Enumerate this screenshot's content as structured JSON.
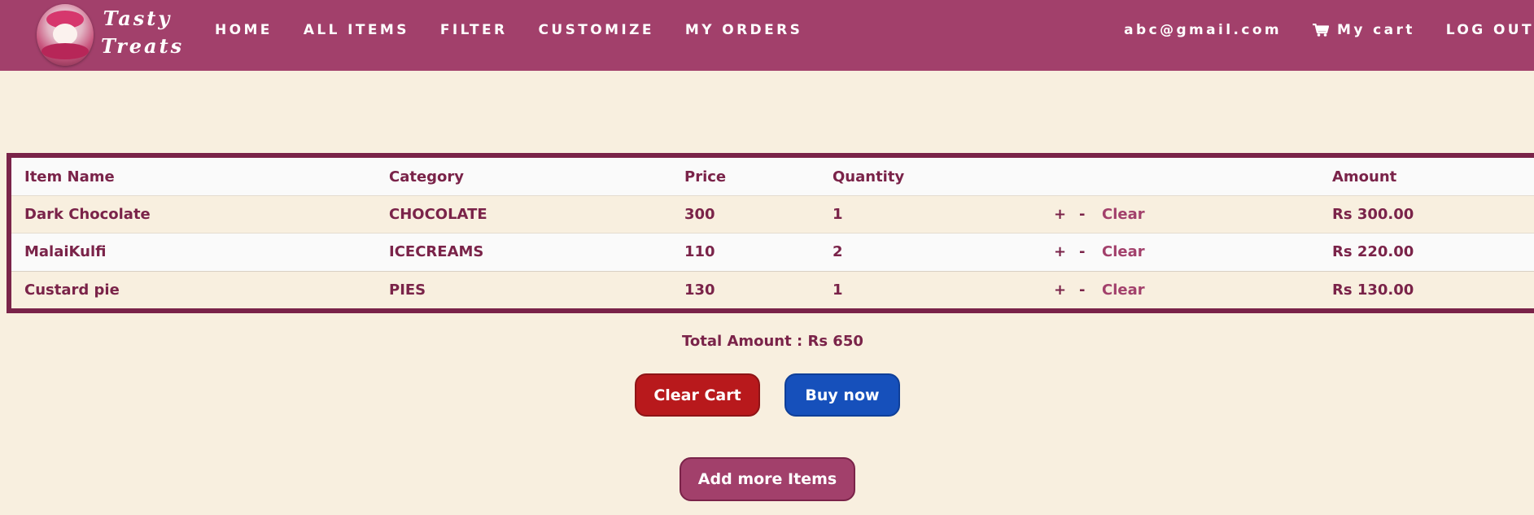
{
  "brand": {
    "line1": "Tasty",
    "line2": "Treats"
  },
  "nav": {
    "links": [
      "HOME",
      "ALL ITEMS",
      "FILTER",
      "CUSTOMIZE",
      "MY ORDERS"
    ],
    "user_email": "abc@gmail.com",
    "cart_label": "My cart",
    "logout_label": "LOG OUT"
  },
  "table": {
    "headers": {
      "name": "Item Name",
      "category": "Category",
      "price": "Price",
      "quantity": "Quantity",
      "amount": "Amount"
    },
    "rows": [
      {
        "name": "Dark Chocolate",
        "category": "CHOCOLATE",
        "price": "300",
        "quantity": "1",
        "plus": "+",
        "minus": "-",
        "clear": "Clear",
        "amount": "Rs 300.00"
      },
      {
        "name": "MalaiKulfi",
        "category": "ICECREAMS",
        "price": "110",
        "quantity": "2",
        "plus": "+",
        "minus": "-",
        "clear": "Clear",
        "amount": "Rs 220.00"
      },
      {
        "name": "Custard pie",
        "category": "PIES",
        "price": "130",
        "quantity": "1",
        "plus": "+",
        "minus": "-",
        "clear": "Clear",
        "amount": "Rs 130.00"
      }
    ]
  },
  "summary": {
    "total_text": "Total Amount : Rs 650"
  },
  "buttons": {
    "clear_cart": "Clear Cart",
    "buy_now": "Buy now",
    "add_more": "Add more Items"
  },
  "colors": {
    "navbar": "#a2406b",
    "text": "#7a2349",
    "background": "#f8efdf",
    "clear_cart": "#b8191c",
    "buy_now": "#1650bb"
  },
  "icons": {
    "logo": "cake-logo-icon",
    "cart": "shopping-cart-icon"
  }
}
